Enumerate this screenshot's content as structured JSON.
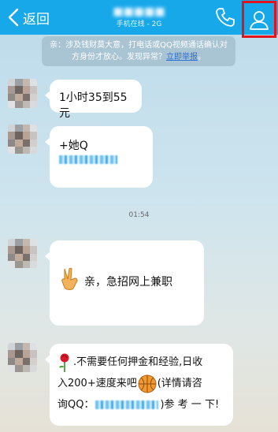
{
  "header": {
    "back_label": "返回",
    "status": "手机在线 - 2G"
  },
  "notice": {
    "text": "亲：涉及钱财莫大意，打电话或QQ视频通话确认对方身份才放心。发现异常？",
    "link": "立即举报",
    "end": "。"
  },
  "messages": [
    {
      "text": "1小时35到55元"
    },
    {
      "prefix": "+她Q"
    },
    {
      "text": "亲，急招网上兼职"
    },
    {
      "line1": ".不需要任何押金和经验,日收",
      "line2a": "入200+速度来吧",
      "line2b": "(详情请咨",
      "line3a": "询QQ：",
      "line3b": ")参 考 一 下!"
    }
  ],
  "time_divider": "01:54",
  "colors": {
    "header_bg": "#17a8ea",
    "highlight_border": "#e1141b",
    "link": "#2a6fd8"
  },
  "icons": {
    "back": "chevron-left-icon",
    "phone": "phone-icon",
    "profile": "person-icon",
    "emoji_v": "victory-hand-icon",
    "emoji_rose": "rose-icon",
    "emoji_ball": "basketball-icon"
  }
}
